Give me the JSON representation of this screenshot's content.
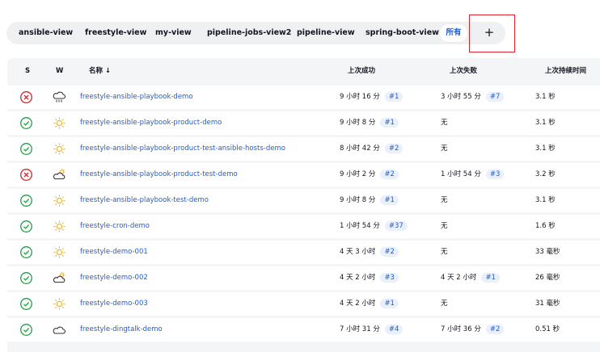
{
  "tabs": [
    "ansible-view",
    "freestyle-view",
    "my-view",
    "pipeline-jobs-view2",
    "pipeline-view",
    "spring-boot-view",
    "所有"
  ],
  "add_label": "+",
  "table": {
    "headers": {
      "s": "S",
      "w": "W",
      "name": "名称 ↓",
      "last_success": "上次成功",
      "last_failure": "上次失败",
      "duration": "上次持续时间"
    },
    "rows": [
      {
        "status": "failed",
        "weather": "rain",
        "name": "freestyle-ansible-playbook-demo",
        "success": "9 小时 16 分",
        "success_build": "#1",
        "failure": "3 小时 55 分",
        "failure_build": "#7",
        "duration": "3.1 秒"
      },
      {
        "status": "success",
        "weather": "sunny",
        "name": "freestyle-ansible-playbook-product-demo",
        "success": "9 小时 8 分",
        "success_build": "#1",
        "failure": "无",
        "failure_build": "",
        "duration": "3.1 秒"
      },
      {
        "status": "success",
        "weather": "sunny",
        "name": "freestyle-ansible-playbook-product-test-ansible-hosts-demo",
        "success": "8 小时 42 分",
        "success_build": "#2",
        "failure": "无",
        "failure_build": "",
        "duration": "3.1 秒"
      },
      {
        "status": "failed",
        "weather": "partly-cloudy",
        "name": "freestyle-ansible-playbook-product-test-demo",
        "success": "9 小时 2 分",
        "success_build": "#2",
        "failure": "1 小时 54 分",
        "failure_build": "#3",
        "duration": "3.2 秒"
      },
      {
        "status": "success",
        "weather": "sunny",
        "name": "freestyle-ansible-playbook-test-demo",
        "success": "9 小时 8 分",
        "success_build": "#1",
        "failure": "无",
        "failure_build": "",
        "duration": "3.1 秒"
      },
      {
        "status": "success",
        "weather": "sunny",
        "name": "freestyle-cron-demo",
        "success": "1 小时 54 分",
        "success_build": "#37",
        "failure": "无",
        "failure_build": "",
        "duration": "1.6 秒"
      },
      {
        "status": "success",
        "weather": "sunny",
        "name": "freestyle-demo-001",
        "success": "4 天 3 小时",
        "success_build": "#2",
        "failure": "无",
        "failure_build": "",
        "duration": "33 毫秒"
      },
      {
        "status": "success",
        "weather": "partly-cloudy",
        "name": "freestyle-demo-002",
        "success": "4 天 2 小时",
        "success_build": "#3",
        "failure": "4 天 2 小时",
        "failure_build": "#1",
        "duration": "26 毫秒"
      },
      {
        "status": "success",
        "weather": "sunny",
        "name": "freestyle-demo-003",
        "success": "4 天 2 小时",
        "success_build": "#1",
        "failure": "无",
        "failure_build": "",
        "duration": "31 毫秒"
      },
      {
        "status": "success",
        "weather": "cloudy",
        "name": "freestyle-dingtalk-demo",
        "success": "7 小时 31 分",
        "success_build": "#4",
        "failure": "7 小时 36 分",
        "failure_build": "#2",
        "duration": "0.51 秒"
      }
    ]
  },
  "colors": {
    "link": "#1a5dd9",
    "success": "#1ea446",
    "failure": "#d9232c",
    "sun": "#f2b233"
  }
}
